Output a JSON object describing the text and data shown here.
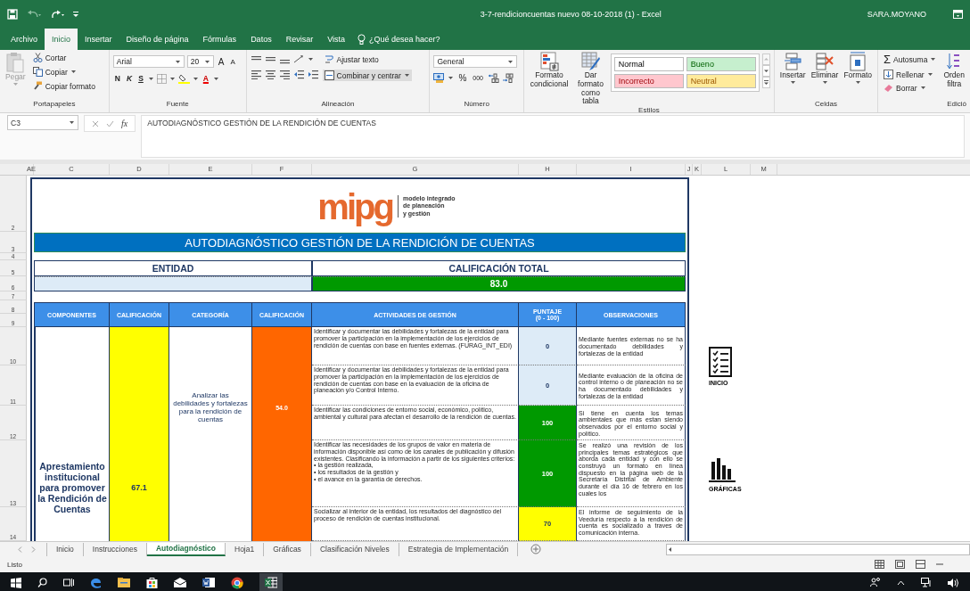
{
  "title_bar": {
    "title": "3-7-rendicioncuentas nuevo 08-10-2018 (1)  -  Excel",
    "user": "SARA.MOYANO"
  },
  "menu_tabs": [
    {
      "label": "Archivo",
      "selected": false
    },
    {
      "label": "Inicio",
      "selected": true
    },
    {
      "label": "Insertar",
      "selected": false
    },
    {
      "label": "Diseño de página",
      "selected": false
    },
    {
      "label": "Fórmulas",
      "selected": false
    },
    {
      "label": "Datos",
      "selected": false
    },
    {
      "label": "Revisar",
      "selected": false
    },
    {
      "label": "Vista",
      "selected": false
    }
  ],
  "tell_me": "¿Qué desea hacer?",
  "ribbon": {
    "clipboard": {
      "paste": "Pegar",
      "cut": "Cortar",
      "copy": "Copiar",
      "format_painter": "Copiar formato",
      "label": "Portapapeles"
    },
    "font": {
      "name": "Arial",
      "size": "20",
      "grow": "A",
      "shrink": "A",
      "bold": "N",
      "italic": "K",
      "underline": "S",
      "font_color": "A",
      "label": "Fuente"
    },
    "alignment": {
      "wrap": "Ajustar texto",
      "merge": "Combinar y centrar",
      "label": "Alineación"
    },
    "number": {
      "format": "General",
      "percent": "%",
      "thousands": "000",
      "label": "Número"
    },
    "styles": {
      "conditional": "Formato condicional",
      "as_table": "Dar formato como tabla",
      "label": "Estilos",
      "cell_styles": [
        {
          "label": "Normal",
          "color": "#ffffff"
        },
        {
          "label": "Bueno",
          "color": "#c6efce"
        },
        {
          "label": "Incorrecto",
          "color": "#ffc7ce"
        },
        {
          "label": "Neutral",
          "color": "#ffeb9c"
        }
      ]
    },
    "cells": {
      "buttons": [
        "Insertar",
        "Eliminar",
        "Formato"
      ],
      "label": "Celdas"
    },
    "editing": {
      "autosum_symbol": "Σ",
      "autosum": "Autosuma",
      "fill": "Rellenar",
      "clear": "Borrar",
      "sort": "Orden\nfiltra",
      "label": "Edició"
    }
  },
  "formula_bar": {
    "name_box": "C3",
    "function_label": "fx",
    "content": "AUTODIAGNÓSTICO GESTIÓN DE LA RENDICIÓN DE CUENTAS"
  },
  "column_headers": [
    "AE",
    "C",
    "D",
    "E",
    "F",
    "G",
    "H",
    "I",
    "J",
    "K",
    "L",
    "M"
  ],
  "row_headers": [
    "2",
    "3",
    "4",
    "5",
    "6",
    "7",
    "8",
    "9",
    "10",
    "11",
    "12",
    "13",
    "14"
  ],
  "logo": {
    "mark": "mipg",
    "tagline": [
      "modelo integrado",
      "de planeación",
      "y gestión"
    ]
  },
  "sheet": {
    "title": "AUTODIAGNÓSTICO GESTIÓN DE LA RENDICIÓN DE CUENTAS",
    "entity_label": "ENTIDAD",
    "total_label": "CALIFICACIÓN TOTAL",
    "total_value": "83.0",
    "columns": [
      "COMPONENTES",
      "CALIFICACIÓN",
      "CATEGORÍA",
      "CALIFICACIÓN",
      "ACTIVIDADES DE GESTIÓN",
      "PUNTAJE\n(0 - 100)",
      "OBSERVACIONES"
    ],
    "component": {
      "name": "Aprestamiento institucional para promover la Rendición de Cuentas",
      "score": "67.1",
      "color": "#ffff00"
    },
    "category": {
      "name": "Analizar las debilidades y fortalezas para la rendición de cuentas",
      "score": "54.0",
      "color": "#ff6600"
    },
    "activities": [
      {
        "text": "Identificar y documentar las debilidades y fortalezas de la entidad para promover la participación  en la implementación de los ejercicios de rendición de cuentas con base en fuentes externas. (FURAG_INT_EDI)",
        "score": "0",
        "color": "#ddebf7",
        "observation": "Mediante fuentes externas no se ha documentado debilidades y fortalezas de la entidad"
      },
      {
        "text": "Identificar y documentar las debilidades y fortalezas de la entidad para promover la participación  en la implementación de los ejercicios de rendición de cuentas con base en  la evaluación de la oficina de planeación y/o Control Interno.",
        "score": "0",
        "color": "#ddebf7",
        "observation": "Mediante evaluación de la oficina de control interno o de planeación no se ha documentado debilidades y fortalezas de la entidad"
      },
      {
        "text": "Identificar las condiciones de entorno social, económico, político, ambiental y cultural para afectan el desarrollo de la rendición de cuentas.",
        "score": "100",
        "color": "#009900",
        "observation": "Si tiene en cuenta los temas ambientales que más estan siendo observados por el entorno social y político."
      },
      {
        "text": "Identificar las necesidades de los grupos de valor en materia de información disponible así como de los canales de publicación y difusión existentes. Clasificando la información a partir de los siguientes criterios:\n• la gestión realizada,\n• los resultados de la gestión y\n• el avance en la garantía de derechos.",
        "score": "100",
        "color": "#009900",
        "observation": "Se realizó una revisión de los principales temas estratégicos que aborda cada entidad y con ello se construyó un formato en línea dispuesto en la página web de la Secretaría Distrital de Ambiente durante el día 16 de febrero en los cuales los"
      },
      {
        "text": "Socializar al interior de la entidad, los resultados del diagnóstico del proceso de rendición de cuentas institucional.",
        "score": "70",
        "color": "#ffff00",
        "observation": "El informe de seguimiento de la Veeduría respecto a la rendición de cuenta es socializado a traves de comunicación interna."
      }
    ]
  },
  "side_buttons": [
    {
      "label": "INICIO",
      "kind": "checklist"
    },
    {
      "label": "GRÁFICAS",
      "kind": "chart"
    }
  ],
  "sheet_tabs": [
    {
      "label": "Inicio",
      "selected": false
    },
    {
      "label": "Instrucciones",
      "selected": false
    },
    {
      "label": "Autodiagnóstico",
      "selected": true
    },
    {
      "label": "Hoja1",
      "selected": false
    },
    {
      "label": "Gráficas",
      "selected": false
    },
    {
      "label": "Clasificación Niveles",
      "selected": false
    },
    {
      "label": "Estrategia de Implementación",
      "selected": false
    }
  ],
  "status": "Listo"
}
